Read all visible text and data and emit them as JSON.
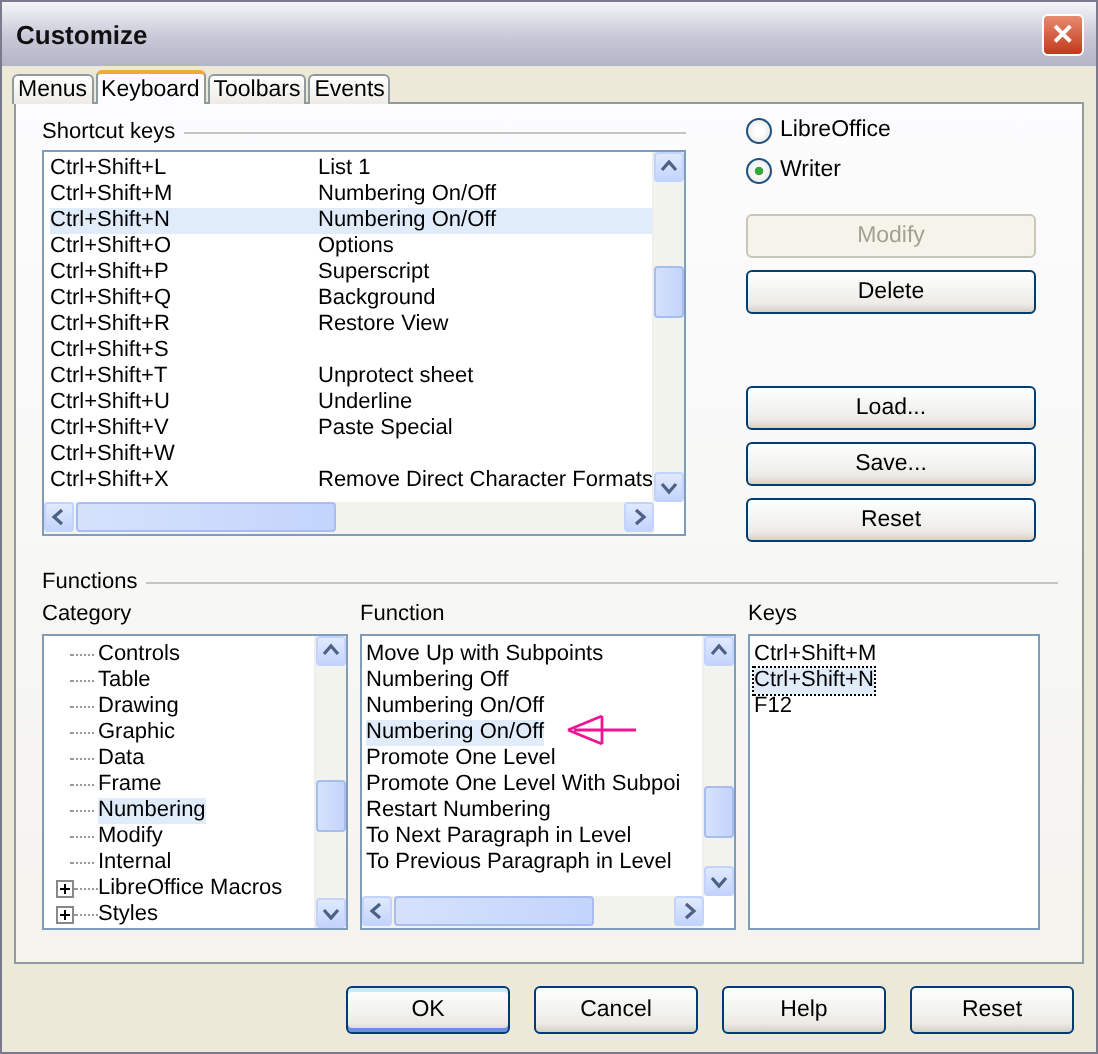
{
  "window": {
    "title": "Customize",
    "close": "✕"
  },
  "tabs": [
    {
      "label": "Menus",
      "selected": false
    },
    {
      "label": "Keyboard",
      "selected": true
    },
    {
      "label": "Toolbars",
      "selected": false
    },
    {
      "label": "Events",
      "selected": false
    }
  ],
  "shortcut_keys": {
    "title": "Shortcut keys",
    "rows": [
      {
        "key": "Ctrl+Shift+L",
        "function": "List 1",
        "selected": false
      },
      {
        "key": "Ctrl+Shift+M",
        "function": "Numbering On/Off",
        "selected": false
      },
      {
        "key": "Ctrl+Shift+N",
        "function": "Numbering On/Off",
        "selected": true
      },
      {
        "key": "Ctrl+Shift+O",
        "function": "Options",
        "selected": false
      },
      {
        "key": "Ctrl+Shift+P",
        "function": "Superscript",
        "selected": false
      },
      {
        "key": "Ctrl+Shift+Q",
        "function": "Background",
        "selected": false
      },
      {
        "key": "Ctrl+Shift+R",
        "function": "Restore View",
        "selected": false
      },
      {
        "key": "Ctrl+Shift+S",
        "selected": false
      },
      {
        "key": "Ctrl+Shift+T",
        "function": "Unprotect sheet",
        "selected": false
      },
      {
        "key": "Ctrl+Shift+U",
        "function": "Underline",
        "selected": false
      },
      {
        "key": "Ctrl+Shift+V",
        "function": "Paste Special",
        "selected": false
      },
      {
        "key": "Ctrl+Shift+W",
        "selected": false
      },
      {
        "key": "Ctrl+Shift+X",
        "function": "Remove Direct Character Formats",
        "selected": false
      }
    ]
  },
  "scope": [
    {
      "label": "LibreOffice",
      "selected": false
    },
    {
      "label": "Writer",
      "selected": true
    }
  ],
  "side_buttons": [
    {
      "label": "Modify",
      "disabled": true
    },
    {
      "label": "Delete",
      "disabled": false
    },
    {
      "label": "Load...",
      "disabled": false
    },
    {
      "label": "Save...",
      "disabled": false
    },
    {
      "label": "Reset",
      "disabled": false
    }
  ],
  "functions": {
    "title": "Functions",
    "category": {
      "label": "Category",
      "items": [
        {
          "label": "Controls",
          "kind": "leaf",
          "selected": false
        },
        {
          "label": "Table",
          "kind": "leaf",
          "selected": false
        },
        {
          "label": "Drawing",
          "kind": "leaf",
          "selected": false
        },
        {
          "label": "Graphic",
          "kind": "leaf",
          "selected": false
        },
        {
          "label": "Data",
          "kind": "leaf",
          "selected": false
        },
        {
          "label": "Frame",
          "kind": "leaf",
          "selected": false
        },
        {
          "label": "Numbering",
          "kind": "leaf",
          "selected": true
        },
        {
          "label": "Modify",
          "kind": "leaf",
          "selected": false
        },
        {
          "label": "Internal",
          "kind": "leaf",
          "selected": false
        },
        {
          "label": "LibreOffice Macros",
          "kind": "folder",
          "expanded": false,
          "selected": false
        },
        {
          "label": "Styles",
          "kind": "folder",
          "expanded": false,
          "selected": false
        }
      ]
    },
    "function": {
      "label": "Function",
      "items": [
        {
          "label": "Move Up with Subpoints",
          "selected": false
        },
        {
          "label": "Numbering Off",
          "selected": false
        },
        {
          "label": "Numbering On/Off",
          "selected": false
        },
        {
          "label": "Numbering On/Off",
          "selected": true
        },
        {
          "label": "Promote One Level",
          "selected": false
        },
        {
          "label": "Promote One Level With Subpoi",
          "selected": false
        },
        {
          "label": "Restart Numbering",
          "selected": false
        },
        {
          "label": "To Next Paragraph in Level",
          "selected": false
        },
        {
          "label": "To Previous Paragraph in Level",
          "selected": false
        }
      ]
    },
    "keys": {
      "label": "Keys",
      "items": [
        {
          "label": "Ctrl+Shift+M",
          "selected": false
        },
        {
          "label": "Ctrl+Shift+N",
          "selected": true
        },
        {
          "label": "F12",
          "selected": false
        }
      ]
    }
  },
  "buttons": [
    {
      "label": "OK",
      "default": true
    },
    {
      "label": "Cancel",
      "default": false
    },
    {
      "label": "Help",
      "default": false
    },
    {
      "label": "Reset",
      "default": false
    }
  ]
}
